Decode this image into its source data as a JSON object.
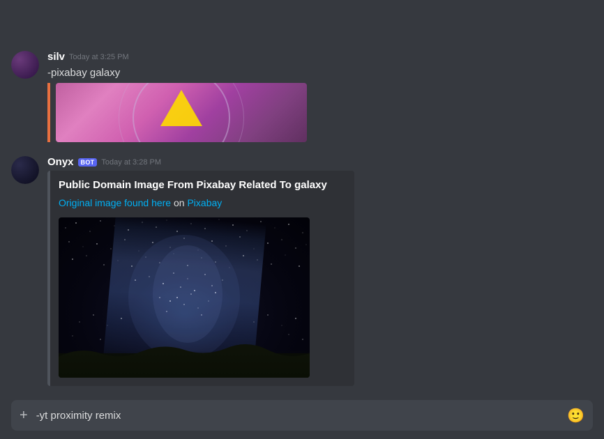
{
  "chat": {
    "messages": [
      {
        "id": "msg-silv",
        "username": "silv",
        "is_bot": false,
        "timestamp": "Today at 3:25 PM",
        "text": "-pixabay galaxy",
        "has_image": true,
        "image_type": "previous"
      },
      {
        "id": "msg-onyx",
        "username": "Onyx",
        "is_bot": true,
        "bot_label": "BOT",
        "timestamp": "Today at 3:28 PM",
        "embed": {
          "title": "Public Domain Image From Pixabay Related To galaxy",
          "description_prefix": "Original image found here",
          "description_on": "on",
          "description_link": "Pixabay",
          "has_image": true
        }
      }
    ]
  },
  "input": {
    "placeholder": "",
    "value": "-yt proximity remix",
    "plus_icon": "+",
    "emoji_icon": "🙂"
  }
}
